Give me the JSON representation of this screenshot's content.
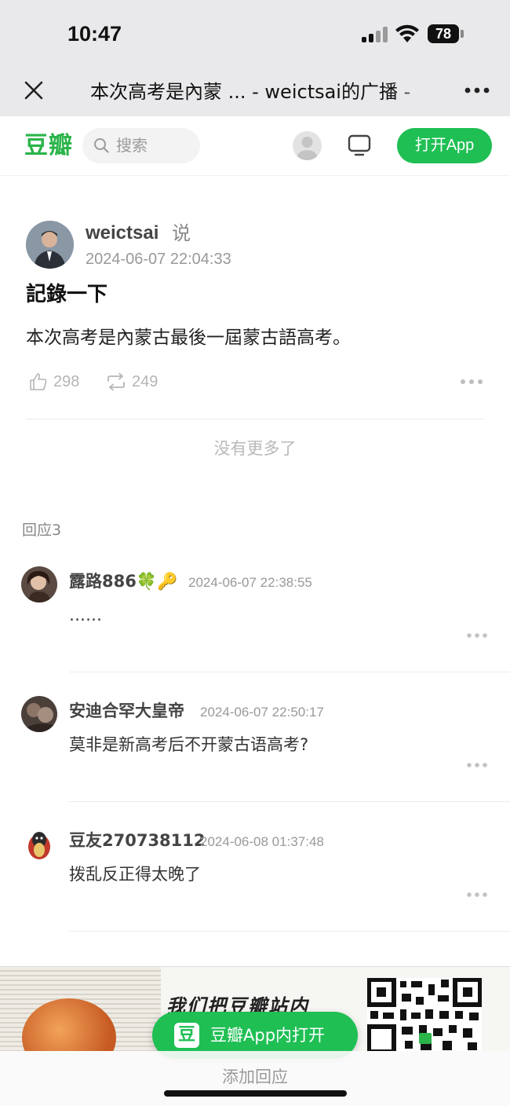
{
  "status_bar": {
    "time": "10:47",
    "battery": "78"
  },
  "browser": {
    "title": "本次高考是內蒙 ... - weictsai的广播 -"
  },
  "header": {
    "logo": "豆瓣",
    "search_placeholder": "搜索",
    "open_app_label": "打开App",
    "accent_color": "#1fbf54"
  },
  "post": {
    "author": "weictsai",
    "says": "说",
    "time": "2024-06-07 22:04:33",
    "title": "記錄一下",
    "body": "本次高考是內蒙古最後一屆蒙古語高考。",
    "likes": "298",
    "reshares": "249",
    "no_more": "没有更多了"
  },
  "replies": {
    "heading": "回应3",
    "items": [
      {
        "name": "露路886🍀🔑",
        "time": "2024-06-07 22:38:55",
        "text": "……"
      },
      {
        "name": "安迪合罕大皇帝",
        "time": "2024-06-07 22:50:17",
        "text": "莫非是新高考后不开蒙古语高考?"
      },
      {
        "name": "豆友270738112",
        "time": "2024-06-08 01:37:48",
        "text": "拨乱反正得太晚了"
      }
    ]
  },
  "banner": {
    "slogan": "我们把豆瓣站内"
  },
  "bottom": {
    "open_in_app_icon": "豆",
    "open_in_app_label": "豆瓣App内打开",
    "add_reply": "添加回应"
  }
}
